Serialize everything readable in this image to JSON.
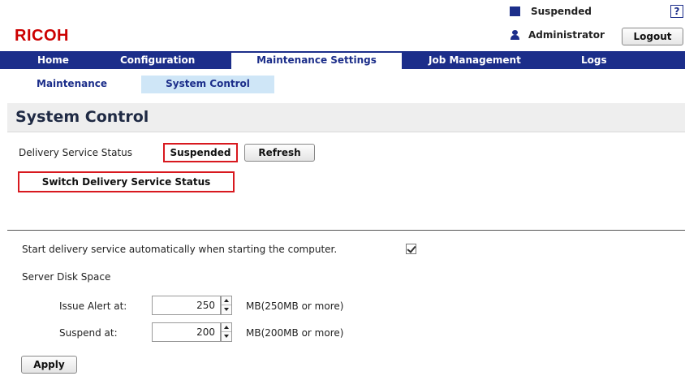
{
  "header": {
    "logo_text": "RICOH",
    "status_text": "Suspended",
    "help_label": "?",
    "user_name": "Administrator",
    "logout_label": "Logout"
  },
  "nav": {
    "tabs": [
      {
        "label": "Home",
        "active": false
      },
      {
        "label": "Configuration",
        "active": false
      },
      {
        "label": "Maintenance Settings",
        "active": true
      },
      {
        "label": "Job Management",
        "active": false
      },
      {
        "label": "Logs",
        "active": false
      }
    ]
  },
  "subnav": {
    "items": [
      {
        "label": "Maintenance",
        "active": false
      },
      {
        "label": "System Control",
        "active": true
      }
    ]
  },
  "page": {
    "title": "System Control"
  },
  "delivery": {
    "status_label": "Delivery Service Status",
    "status_value": "Suspended",
    "refresh_label": "Refresh",
    "switch_label": "Switch Delivery Service Status"
  },
  "settings": {
    "autostart_label": "Start delivery service automatically when starting the computer.",
    "autostart_checked": true,
    "disk_space_label": "Server Disk Space",
    "issue_alert_label": "Issue Alert at:",
    "issue_alert_value": "250",
    "issue_alert_hint": "MB(250MB or more)",
    "suspend_label": "Suspend at:",
    "suspend_value": "200",
    "suspend_hint": "MB(200MB or more)",
    "apply_label": "Apply"
  },
  "colors": {
    "brand_red": "#cc0000",
    "nav_blue": "#1c2e8a",
    "highlight_red": "#d8191f",
    "subnav_active_bg": "#cfe6f7"
  }
}
